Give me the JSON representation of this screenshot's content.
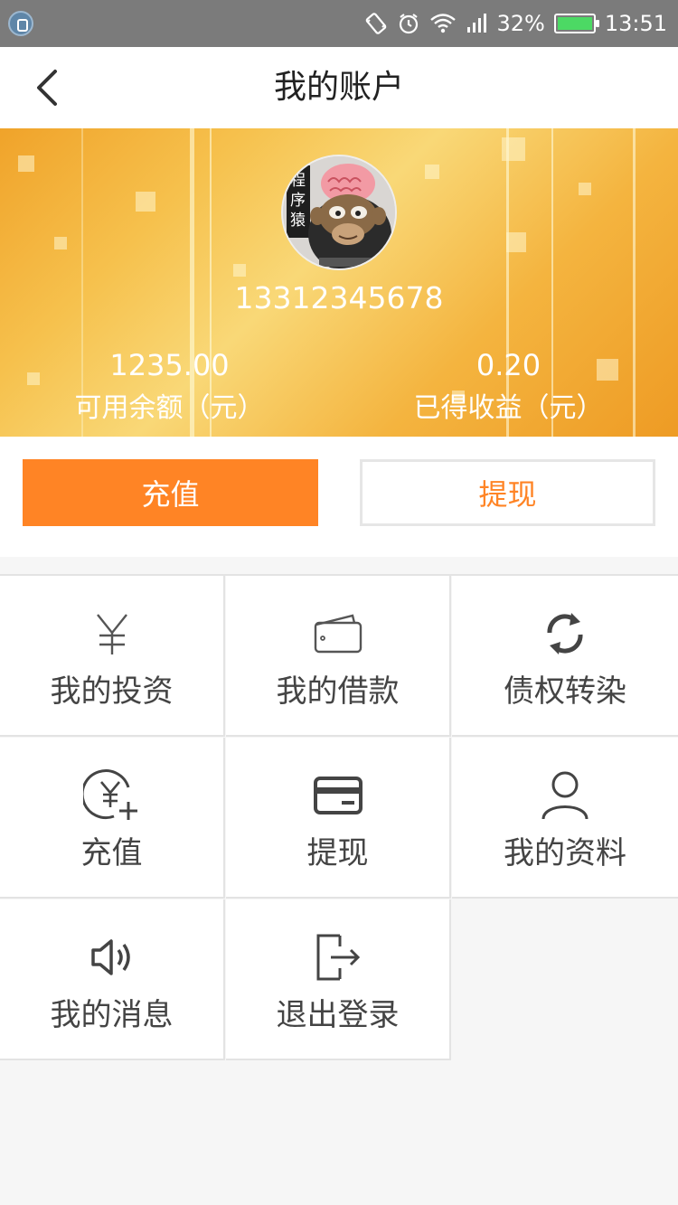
{
  "status_bar": {
    "battery": "32%",
    "time": "13:51",
    "icons": [
      "notification-icon",
      "vibrate-icon",
      "alarm-icon",
      "wifi-icon",
      "signal-icon",
      "battery-icon"
    ]
  },
  "nav": {
    "title": "我的账户",
    "back_icon": "chevron-left-icon"
  },
  "account": {
    "phone": "13312345678",
    "balance_value": "1235.00",
    "balance_label": "可用余额（元）",
    "earnings_value": "0.20",
    "earnings_label": "已得收益（元）"
  },
  "actions": {
    "recharge": "充值",
    "withdraw": "提现"
  },
  "menu": {
    "items": [
      {
        "label": "我的投资",
        "icon": "yen-icon"
      },
      {
        "label": "我的借款",
        "icon": "wallet-icon"
      },
      {
        "label": "债权转染",
        "icon": "refresh-icon"
      },
      {
        "label": "充值",
        "icon": "yen-add-icon"
      },
      {
        "label": "提现",
        "icon": "card-icon"
      },
      {
        "label": "我的资料",
        "icon": "user-icon"
      },
      {
        "label": "我的消息",
        "icon": "speaker-icon"
      },
      {
        "label": "退出登录",
        "icon": "logout-icon"
      }
    ]
  },
  "colors": {
    "accent": "#ff8425",
    "status_bar": "#7b7b7b",
    "banner": "#f4b43f"
  }
}
